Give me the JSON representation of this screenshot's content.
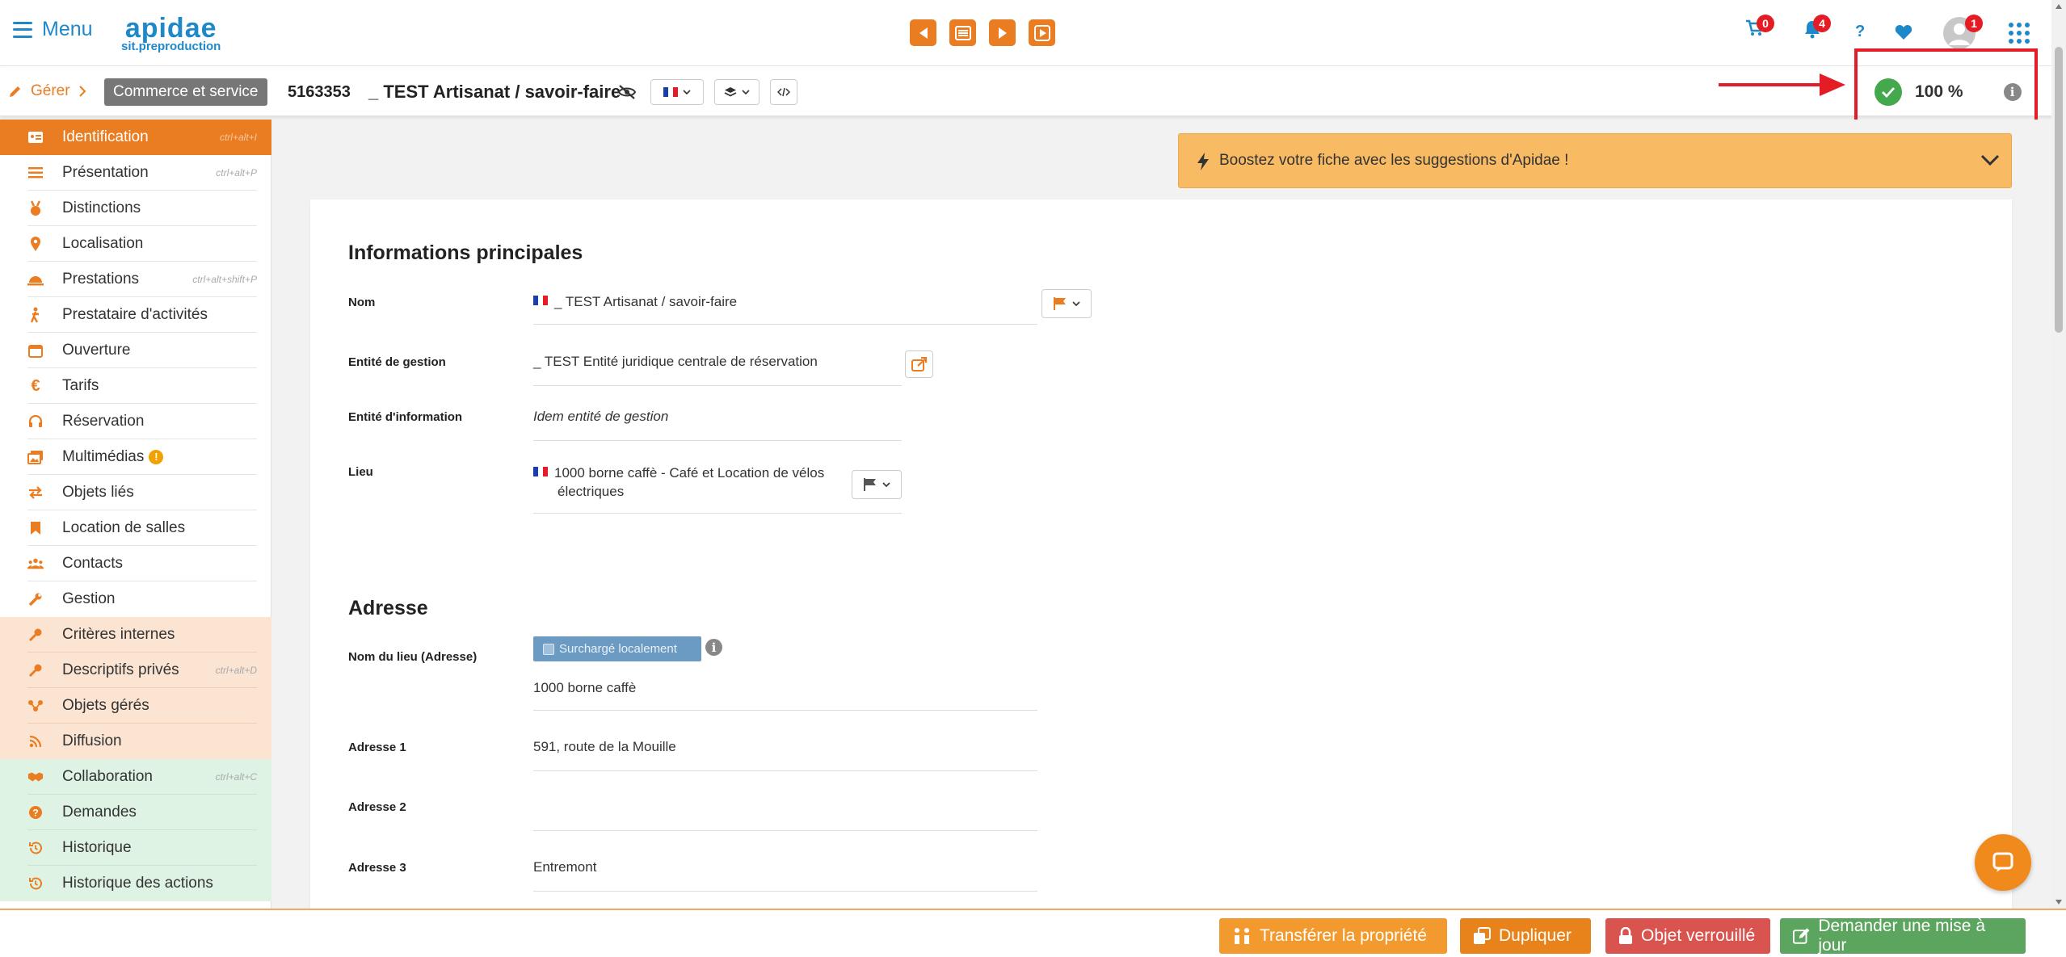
{
  "topbar": {
    "menu_label": "Menu",
    "logo_main": "apidae",
    "logo_sub": "sit.preproduction",
    "cart_count": "0",
    "notif_count": "4",
    "help": "?",
    "avatar_count": "1"
  },
  "subbar": {
    "breadcrumb": "Gérer",
    "category": "Commerce et service",
    "object_id": "5163353",
    "object_title": "_ TEST Artisanat / savoir-faire",
    "completion": "100 %"
  },
  "sidebar": {
    "items": [
      {
        "label": "Identification",
        "shortcut": "ctrl+alt+I"
      },
      {
        "label": "Présentation",
        "shortcut": "ctrl+alt+P"
      },
      {
        "label": "Distinctions",
        "shortcut": ""
      },
      {
        "label": "Localisation",
        "shortcut": ""
      },
      {
        "label": "Prestations",
        "shortcut": "ctrl+alt+shift+P"
      },
      {
        "label": "Prestataire d'activités",
        "shortcut": ""
      },
      {
        "label": "Ouverture",
        "shortcut": ""
      },
      {
        "label": "Tarifs",
        "shortcut": ""
      },
      {
        "label": "Réservation",
        "shortcut": ""
      },
      {
        "label": "Multimédias",
        "shortcut": ""
      },
      {
        "label": "Objets liés",
        "shortcut": ""
      },
      {
        "label": "Location de salles",
        "shortcut": ""
      },
      {
        "label": "Contacts",
        "shortcut": ""
      },
      {
        "label": "Gestion",
        "shortcut": ""
      },
      {
        "label": "Critères internes",
        "shortcut": ""
      },
      {
        "label": "Descriptifs privés",
        "shortcut": "ctrl+alt+D"
      },
      {
        "label": "Objets gérés",
        "shortcut": ""
      },
      {
        "label": "Diffusion",
        "shortcut": ""
      },
      {
        "label": "Collaboration",
        "shortcut": "ctrl+alt+C"
      },
      {
        "label": "Demandes",
        "shortcut": ""
      },
      {
        "label": "Historique",
        "shortcut": ""
      },
      {
        "label": "Historique des actions",
        "shortcut": ""
      }
    ]
  },
  "boost": {
    "text": "Boostez votre fiche avec les suggestions d'Apidae !"
  },
  "main": {
    "section_info": "Informations principales",
    "nom_label": "Nom",
    "nom_value": "_ TEST Artisanat / savoir-faire",
    "entite_gestion_label": "Entité de gestion",
    "entite_gestion_value": "_ TEST Entité juridique centrale de réservation",
    "entite_info_label": "Entité d'information",
    "entite_info_value": "Idem entité de gestion",
    "lieu_label": "Lieu",
    "lieu_value_1": "1000 borne caffè -  Café et Location de vélos",
    "lieu_value_2": "électriques",
    "section_adresse": "Adresse",
    "nom_lieu_label": "Nom du lieu (Adresse)",
    "override_label": "Surchargé localement",
    "nom_lieu_value": "1000 borne caffè",
    "adresse1_label": "Adresse 1",
    "adresse1_value": "591, route de la Mouille",
    "adresse2_label": "Adresse 2",
    "adresse2_value": "",
    "adresse3_label": "Adresse 3",
    "adresse3_value": "Entremont"
  },
  "bottombar": {
    "transfer": "Transférer la propriété",
    "duplicate": "Dupliquer",
    "locked": "Objet verrouillé",
    "request_update": "Demander une mise à jour"
  },
  "colors": {
    "accent": "#ea7d21",
    "brand_blue": "#1f88c9",
    "alert_red": "#e31c25",
    "success_green": "#44a84c",
    "locked_red": "#d9534f",
    "update_green": "#5ca55f"
  }
}
